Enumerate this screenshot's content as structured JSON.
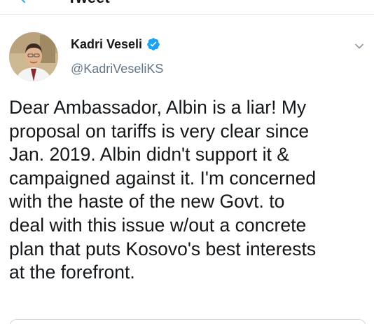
{
  "header": {
    "title": "Tweet"
  },
  "tweet": {
    "author": {
      "display_name": "Kadri Veseli",
      "handle": "@KadriVeseliKS",
      "verified": true
    },
    "text": "Dear Ambassador, Albin is a liar! My\nproposal on tariffs is very clear since\nJan. 2019. Albin didn't support it &\ncampaigned against it. I'm concerned\nwith the haste of the new Govt. to\ndeal with this issue w/out a concrete\nplan that puts Kosovo's best interests\nat the forefront."
  },
  "icons": {
    "back": "back-arrow-icon",
    "verified": "verified-badge-icon",
    "menu": "chevron-down-icon"
  },
  "colors": {
    "accent": "#1da1f2",
    "text_primary": "#14171a",
    "text_secondary": "#657786"
  }
}
